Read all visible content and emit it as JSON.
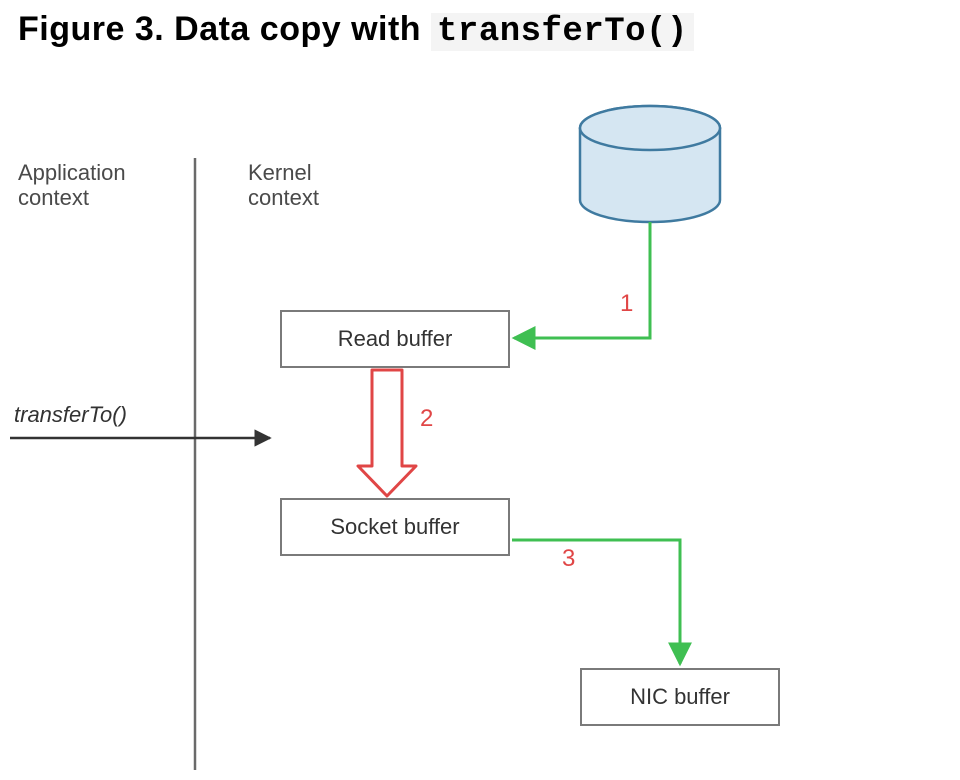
{
  "figure": {
    "title_prefix": "Figure 3. Data copy with ",
    "title_code": "transferTo()"
  },
  "labels": {
    "application_context": "Application\ncontext",
    "kernel_context": "Kernel\ncontext",
    "method_call": "transferTo()"
  },
  "boxes": {
    "read_buffer": "Read buffer",
    "socket_buffer": "Socket buffer",
    "nic_buffer": "NIC buffer"
  },
  "steps": {
    "step1": "1",
    "step2": "2",
    "step3": "3"
  },
  "diagram": {
    "nodes": [
      {
        "id": "disk",
        "type": "cylinder",
        "label": null
      },
      {
        "id": "read_buffer",
        "type": "box",
        "label": "Read buffer"
      },
      {
        "id": "socket_buffer",
        "type": "box",
        "label": "Socket buffer"
      },
      {
        "id": "nic_buffer",
        "type": "box",
        "label": "NIC buffer"
      }
    ],
    "edges": [
      {
        "from": "disk",
        "to": "read_buffer",
        "step": "1",
        "kind": "dma"
      },
      {
        "from": "read_buffer",
        "to": "socket_buffer",
        "step": "2",
        "kind": "cpu_copy"
      },
      {
        "from": "socket_buffer",
        "to": "nic_buffer",
        "step": "3",
        "kind": "dma"
      }
    ],
    "contexts": [
      "Application context",
      "Kernel context"
    ],
    "syscall": "transferTo()"
  }
}
